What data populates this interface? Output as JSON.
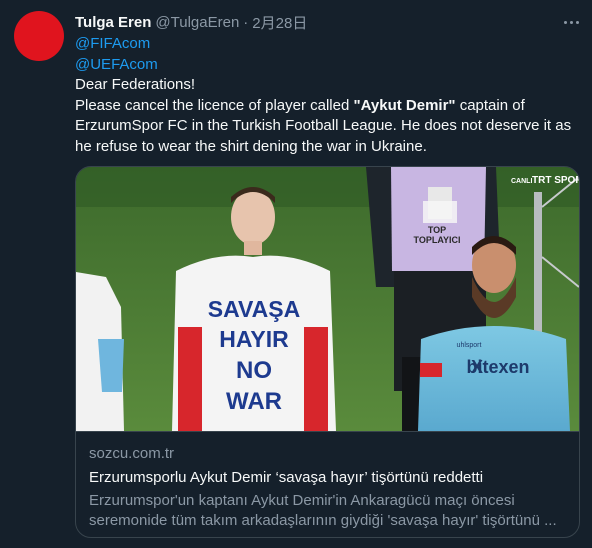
{
  "tweet": {
    "author_name": "Tulga Eren",
    "author_handle": "@TulgaEren",
    "separator": "·",
    "timestamp": "2月28日",
    "more_icon": "more-horizontal-icon",
    "mentions": [
      "@FIFAcom",
      "@UEFAcom"
    ],
    "greeting": "Dear Federations!",
    "body_part1": "Please cancel the licence of player called ",
    "body_bold": "\"Aykut Demir\"",
    "body_part2": " captain of",
    "body_line2": "ErzurumSpor FC in the Turkish Football League. He does not deserve it as",
    "body_line3": "he refuse to wear the shirt dening the war in Ukraine."
  },
  "card": {
    "image_texts": {
      "shirt_line1": "SAVAŞA",
      "shirt_line2": "HAYIR",
      "shirt_line3": "NO",
      "shirt_line4": "WAR",
      "vest_line1": "TOP",
      "vest_line2": "TOPLAYICI",
      "jersey_sponsor": "bitexen",
      "jersey_brand": "uhlsport",
      "broadcast_logo": "TRT SPOR",
      "broadcast_tag": "CANLI"
    },
    "domain": "sozcu.com.tr",
    "title": "Erzurumsporlu Aykut Demir ‘savaşa hayır’ tişörtünü reddetti",
    "description_line1": "Erzurumspor'un kaptanı Aykut Demir'in Ankaragücü maçı öncesi",
    "description_line2": "seremonide tüm takım arkadaşlarının giydiği 'savaşa hayır' tişörtünü ..."
  },
  "colors": {
    "background": "#15202b",
    "link": "#1d9bf0",
    "secondary_text": "#8b98a5",
    "avatar": "#e0141e",
    "border": "#38444d"
  }
}
